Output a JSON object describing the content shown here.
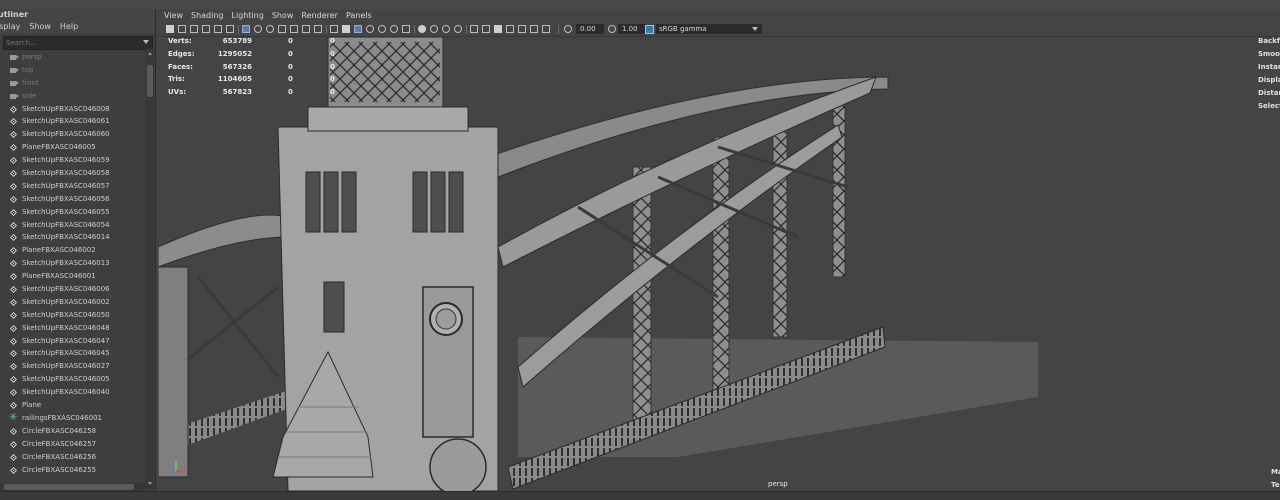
{
  "outliner": {
    "title": "utliner",
    "menu": [
      "isplay",
      "Show",
      "Help"
    ],
    "search_placeholder": "Search...",
    "items": [
      {
        "label": "persp",
        "icon": "camera-icon",
        "dim": true
      },
      {
        "label": "top",
        "icon": "camera-icon",
        "dim": true
      },
      {
        "label": "front",
        "icon": "camera-icon",
        "dim": true
      },
      {
        "label": "side",
        "icon": "camera-icon",
        "dim": true
      },
      {
        "label": "SketchUpFBXASC046008",
        "icon": "mesh-icon"
      },
      {
        "label": "SketchUpFBXASC046061",
        "icon": "mesh-icon"
      },
      {
        "label": "SketchUpFBXASC046060",
        "icon": "mesh-icon"
      },
      {
        "label": "PlaneFBXASC046005",
        "icon": "mesh-icon"
      },
      {
        "label": "SketchUpFBXASC046059",
        "icon": "mesh-icon"
      },
      {
        "label": "SketchUpFBXASC046058",
        "icon": "mesh-icon"
      },
      {
        "label": "SketchUpFBXASC046057",
        "icon": "mesh-icon"
      },
      {
        "label": "SketchUpFBXASC046056",
        "icon": "mesh-icon"
      },
      {
        "label": "SketchUpFBXASC046055",
        "icon": "mesh-icon"
      },
      {
        "label": "SketchUpFBXASC046054",
        "icon": "mesh-icon"
      },
      {
        "label": "SketchUpFBXASC046014",
        "icon": "mesh-icon"
      },
      {
        "label": "PlaneFBXASC046002",
        "icon": "mesh-icon"
      },
      {
        "label": "SketchUpFBXASC046013",
        "icon": "mesh-icon"
      },
      {
        "label": "PlaneFBXASC046001",
        "icon": "mesh-icon"
      },
      {
        "label": "SketchUpFBXASC046006",
        "icon": "mesh-icon"
      },
      {
        "label": "SketchUpFBXASC046002",
        "icon": "mesh-icon"
      },
      {
        "label": "SketchUpFBXASC046050",
        "icon": "mesh-icon"
      },
      {
        "label": "SketchUpFBXASC046048",
        "icon": "mesh-icon"
      },
      {
        "label": "SketchUpFBXASC046047",
        "icon": "mesh-icon"
      },
      {
        "label": "SketchUpFBXASC046045",
        "icon": "mesh-icon"
      },
      {
        "label": "SketchUpFBXASC046027",
        "icon": "mesh-icon"
      },
      {
        "label": "SketchUpFBXASC046005",
        "icon": "mesh-icon"
      },
      {
        "label": "SketchUpFBXASC046040",
        "icon": "mesh-icon"
      },
      {
        "label": "Plane",
        "icon": "mesh-icon"
      },
      {
        "label": "railingsFBXASC046001",
        "icon": "joint-star-icon"
      },
      {
        "label": "CircleFBXASC046258",
        "icon": "mesh-icon"
      },
      {
        "label": "CircleFBXASC046257",
        "icon": "mesh-icon"
      },
      {
        "label": "CircleFBXASC046256",
        "icon": "mesh-icon"
      },
      {
        "label": "CircleFBXASC046255",
        "icon": "mesh-icon"
      }
    ]
  },
  "viewport": {
    "menu": [
      "View",
      "Shading",
      "Lighting",
      "Show",
      "Renderer",
      "Panels"
    ],
    "exposure": "0.00",
    "gamma": "1.00",
    "color_space": "sRGB gamma",
    "camera_label": "persp",
    "hud_stats": [
      {
        "label": "Verts:",
        "value": "653789",
        "sel": "0",
        "extra": "0"
      },
      {
        "label": "Edges:",
        "value": "1295052",
        "sel": "0",
        "extra": "0"
      },
      {
        "label": "Faces:",
        "value": "567326",
        "sel": "0",
        "extra": "0"
      },
      {
        "label": "Tris:",
        "value": "1104605",
        "sel": "0",
        "extra": "0"
      },
      {
        "label": "UVs:",
        "value": "567823",
        "sel": "0",
        "extra": "0"
      }
    ],
    "hud_right": [
      "Backfa",
      "Smoot",
      "Instan",
      "Displa",
      "Distan",
      "Select"
    ],
    "hud_right_bottom": [
      "Ma",
      "Te"
    ]
  }
}
